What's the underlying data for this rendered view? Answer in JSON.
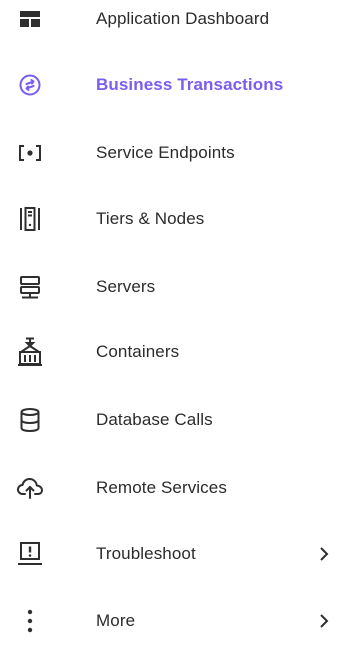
{
  "colors": {
    "accent": "#7b5cf0",
    "text": "#2b2b2b",
    "icon": "#2f2f2f"
  },
  "nav": {
    "items": [
      {
        "label": "Application Dashboard",
        "icon": "dashboard-icon",
        "active": false
      },
      {
        "label": "Business Transactions",
        "icon": "transactions-icon",
        "active": true
      },
      {
        "label": "Service Endpoints",
        "icon": "service-endpoint-icon",
        "active": false
      },
      {
        "label": "Tiers & Nodes",
        "icon": "tiers-nodes-icon",
        "active": false
      },
      {
        "label": "Servers",
        "icon": "servers-icon",
        "active": false
      },
      {
        "label": "Containers",
        "icon": "containers-icon",
        "active": false
      },
      {
        "label": "Database Calls",
        "icon": "database-icon",
        "active": false
      },
      {
        "label": "Remote Services",
        "icon": "cloud-upload-icon",
        "active": false
      },
      {
        "label": "Troubleshoot",
        "icon": "troubleshoot-icon",
        "active": false,
        "has_submenu": true
      },
      {
        "label": "More",
        "icon": "more-vertical-icon",
        "active": false,
        "has_submenu": true
      }
    ]
  }
}
